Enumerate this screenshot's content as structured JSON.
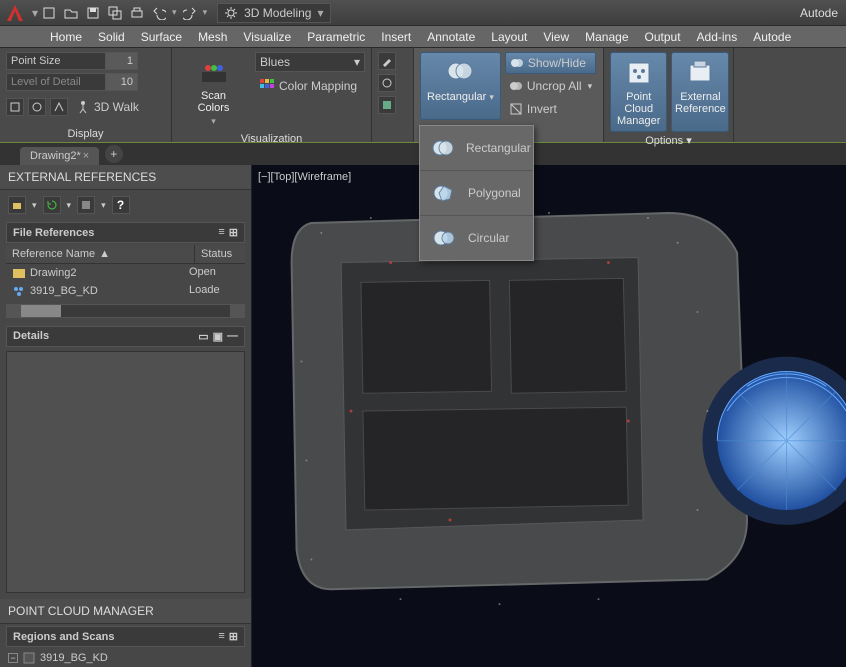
{
  "titlebar": {
    "app_name": "Autode",
    "workspace": "3D Modeling"
  },
  "tabs": [
    "Home",
    "Solid",
    "Surface",
    "Mesh",
    "Visualize",
    "Parametric",
    "Insert",
    "Annotate",
    "Layout",
    "View",
    "Manage",
    "Output",
    "Add-ins",
    "Autode"
  ],
  "ribbon": {
    "display": {
      "label": "Display",
      "point_size_label": "Point Size",
      "point_size_value": "1",
      "lod_label": "Level of Detail",
      "lod_value": "10",
      "walk_label": "3D Walk"
    },
    "visualization": {
      "label": "Visualization",
      "scan_colors": "Scan Colors",
      "colorization": "Blues",
      "color_mapping": "Color Mapping"
    },
    "cropping": {
      "rectangular": "Rectangular",
      "show_hide": "Show/Hide",
      "uncrop_all": "Uncrop All",
      "invert": "Invert"
    },
    "options": {
      "label": "Options",
      "pcm": "Point Cloud\nManager",
      "extref": "External\nReference"
    }
  },
  "dropdown": {
    "items": [
      "Rectangular",
      "Polygonal",
      "Circular"
    ]
  },
  "doctab": {
    "name": "Drawing2*"
  },
  "viewport": {
    "controls": "[−][Top][Wireframe]"
  },
  "external_refs": {
    "title": "EXTERNAL REFERENCES",
    "file_refs_label": "File References",
    "col1": "Reference Name",
    "col2": "Status",
    "rows": [
      {
        "name": "Drawing2",
        "status": "Open"
      },
      {
        "name": "3919_BG_KD",
        "status": "Loade"
      }
    ],
    "details_label": "Details"
  },
  "pcm_panel": {
    "title": "POINT CLOUD MANAGER",
    "regions_label": "Regions and Scans",
    "tree_root": "3919_BG_KD"
  }
}
